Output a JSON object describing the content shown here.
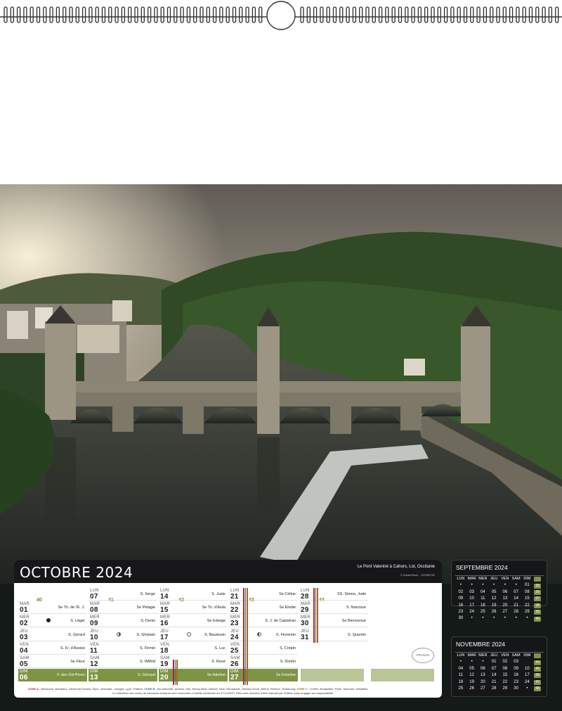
{
  "photo_caption": "Le Pont Valentré à Cahors, Lot, Occitanie",
  "photo_credit": "© AdobeStock · 123456789",
  "month_title": "OCTOBRE 2024",
  "colors": {
    "green": "#7e9445",
    "header": "#17171a",
    "band": "#141a17"
  },
  "weeks": [
    {
      "num": "40",
      "days": [
        {
          "dn": "MAR",
          "d": "01",
          "saint": "Se Th. de l'E. J."
        },
        {
          "dn": "MER",
          "d": "02",
          "saint": "S. Léger",
          "moon": "new"
        },
        {
          "dn": "JEU",
          "d": "03",
          "saint": "S. Gérard"
        },
        {
          "dn": "VEN",
          "d": "04",
          "saint": "S. Fr. d'Assise"
        },
        {
          "dn": "SAM",
          "d": "05",
          "saint": "Se Fleur"
        },
        {
          "dn": "DIM",
          "d": "06",
          "saint": "F. des Gd-Pères"
        }
      ]
    },
    {
      "num": "41",
      "days": [
        {
          "dn": "LUN",
          "d": "07",
          "saint": "S. Serge"
        },
        {
          "dn": "MAR",
          "d": "08",
          "saint": "Se Pélagie"
        },
        {
          "dn": "MER",
          "d": "09",
          "saint": "S. Denis"
        },
        {
          "dn": "JEU",
          "d": "10",
          "saint": "S. Ghislain",
          "moon": "fq"
        },
        {
          "dn": "VEN",
          "d": "11",
          "saint": "S. Firmin"
        },
        {
          "dn": "SAM",
          "d": "12",
          "saint": "S. Wilfrid"
        },
        {
          "dn": "DIM",
          "d": "13",
          "saint": "S. Géraud"
        }
      ]
    },
    {
      "num": "42",
      "days": [
        {
          "dn": "LUN",
          "d": "14",
          "saint": "S. Juste"
        },
        {
          "dn": "MAR",
          "d": "15",
          "saint": "Se Th. d'Avila"
        },
        {
          "dn": "MER",
          "d": "16",
          "saint": "Se Edwige"
        },
        {
          "dn": "JEU",
          "d": "17",
          "saint": "S. Baudouin",
          "moon": "full"
        },
        {
          "dn": "VEN",
          "d": "18",
          "saint": "S. Luc"
        },
        {
          "dn": "SAM",
          "d": "19",
          "saint": "S. René"
        },
        {
          "dn": "DIM",
          "d": "20",
          "saint": "Se Adeline"
        }
      ]
    },
    {
      "num": "43",
      "days": [
        {
          "dn": "LUN",
          "d": "21",
          "saint": "Se Céline"
        },
        {
          "dn": "MAR",
          "d": "22",
          "saint": "Se Élodie"
        },
        {
          "dn": "MER",
          "d": "23",
          "saint": "S. J. de Capistran"
        },
        {
          "dn": "JEU",
          "d": "24",
          "saint": "S. Florentin",
          "moon": "lq"
        },
        {
          "dn": "VEN",
          "d": "25",
          "saint": "S. Crépin"
        },
        {
          "dn": "SAM",
          "d": "26",
          "saint": "S. Dimitri"
        },
        {
          "dn": "DIM",
          "d": "27",
          "saint": "Se Emeline"
        }
      ]
    },
    {
      "num": "44",
      "days": [
        {
          "dn": "LUN",
          "d": "28",
          "saint": "SS. Simon, Jude"
        },
        {
          "dn": "MAR",
          "d": "29",
          "saint": "S. Narcisse"
        },
        {
          "dn": "MER",
          "d": "30",
          "saint": "Se Bienvenue"
        },
        {
          "dn": "JEU",
          "d": "31",
          "saint": "S. Quentin"
        }
      ]
    }
  ],
  "footer": {
    "zone_a_label": "ZONE A :",
    "zone_a": "Besançon, Bordeaux, Clermont-Ferrand, Dijon, Grenoble, Limoges, Lyon, Poitiers.",
    "zone_b_label": "ZONE B :",
    "zone_b": "Aix-Marseille, Amiens, Lille, Nancy-Metz, Nantes, Nice, Normandie, Orléans-Tours, Reims, Rennes, Strasbourg.",
    "zone_c_label": "ZONE C :",
    "zone_c": "Créteil, Montpellier, Paris, Toulouse, Versailles.",
    "note": "Le calendrier des zones de vacances scolaires sont conformes à l'arrêté ministériel du 07/12/2022. Elles sont données à titre indicatif par l'éditeur sans engager sa responsabilité."
  },
  "stamp_text": "FRANCE",
  "mini_months": [
    {
      "title": "SEPTEMBRE 2024",
      "head": [
        "LUN",
        "MAR",
        "MER",
        "JEU",
        "VEN",
        "SAM",
        "DIM"
      ],
      "rows": [
        [
          "•",
          "•",
          "•",
          "•",
          "•",
          "•",
          "01",
          "35"
        ],
        [
          "02",
          "03",
          "04",
          "05",
          "06",
          "07",
          "08",
          "36"
        ],
        [
          "09",
          "10",
          "11",
          "12",
          "13",
          "14",
          "15",
          "37"
        ],
        [
          "16",
          "17",
          "18",
          "19",
          "20",
          "21",
          "22",
          "38"
        ],
        [
          "23",
          "24",
          "25",
          "26",
          "27",
          "28",
          "29",
          "39"
        ],
        [
          "30",
          "•",
          "•",
          "•",
          "•",
          "•",
          "•",
          "40"
        ]
      ]
    },
    {
      "title": "NOVEMBRE 2024",
      "head": [
        "LUN",
        "MAR",
        "MER",
        "JEU",
        "VEN",
        "SAM",
        "DIM"
      ],
      "rows": [
        [
          "•",
          "•",
          "•",
          "01",
          "02",
          "03",
          "",
          "44"
        ],
        [
          "04",
          "05",
          "06",
          "07",
          "08",
          "09",
          "10",
          "45"
        ],
        [
          "11",
          "12",
          "13",
          "14",
          "15",
          "16",
          "17",
          "46"
        ],
        [
          "18",
          "19",
          "20",
          "21",
          "22",
          "23",
          "24",
          "47"
        ],
        [
          "25",
          "26",
          "27",
          "28",
          "29",
          "30",
          "•",
          "48"
        ]
      ]
    }
  ]
}
